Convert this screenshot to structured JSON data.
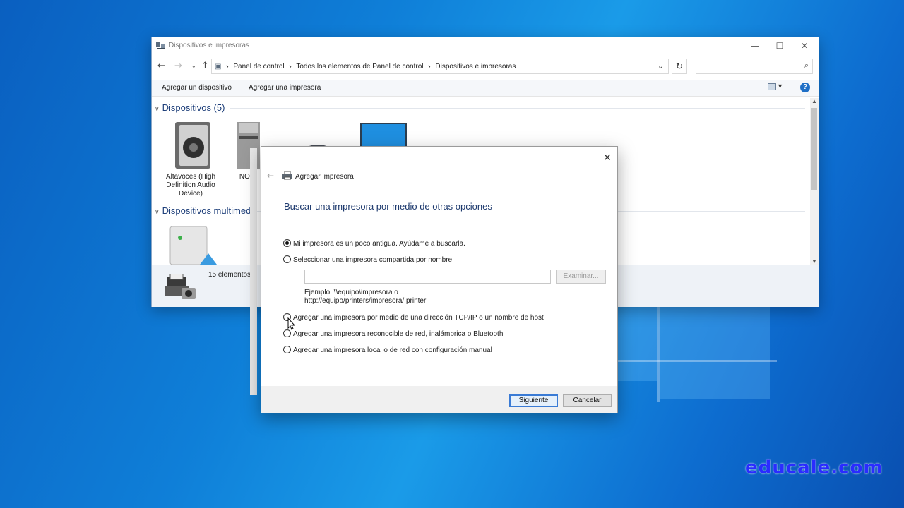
{
  "explorer": {
    "title": "Dispositivos e impresoras",
    "breadcrumbs": [
      "Panel de control",
      "Todos los elementos de Panel de control",
      "Dispositivos e impresoras"
    ],
    "search_placeholder": "",
    "toolbar": {
      "add_device": "Agregar un dispositivo",
      "add_printer": "Agregar una impresora"
    },
    "groups": [
      {
        "label": "Dispositivos (5)"
      },
      {
        "label": "Dispositivos multimed"
      }
    ],
    "devices": [
      {
        "label": "Altavoces (High Definition Audio Device)"
      },
      {
        "label": "NOC"
      }
    ],
    "status": {
      "count": "15 elementos"
    }
  },
  "dialog": {
    "title": "Agregar impresora",
    "heading": "Buscar una impresora por medio de otras opciones",
    "options": [
      {
        "label": "Mi impresora es un poco antigua. Ayúdame a buscarla.",
        "checked": true
      },
      {
        "label": "Seleccionar una impresora compartida por nombre",
        "checked": false
      },
      {
        "label": "Agregar una impresora por medio de una dirección TCP/IP o un nombre de host",
        "checked": false
      },
      {
        "label": "Agregar una impresora reconocible de red, inalámbrica o Bluetooth",
        "checked": false
      },
      {
        "label": "Agregar una impresora local o de red con configuración manual",
        "checked": false
      }
    ],
    "name_input": {
      "value": ""
    },
    "browse_label": "Examinar...",
    "example_line1": "Ejemplo: \\\\equipo\\impresora o",
    "example_line2": "http://equipo/printers/impresora/.printer",
    "next_label": "Siguiente",
    "cancel_label": "Cancelar"
  },
  "watermark": "educale.com",
  "colors": {
    "accent": "#1f6fc6",
    "heading": "#1e3a6e",
    "desktop": "#0f7fd8"
  }
}
